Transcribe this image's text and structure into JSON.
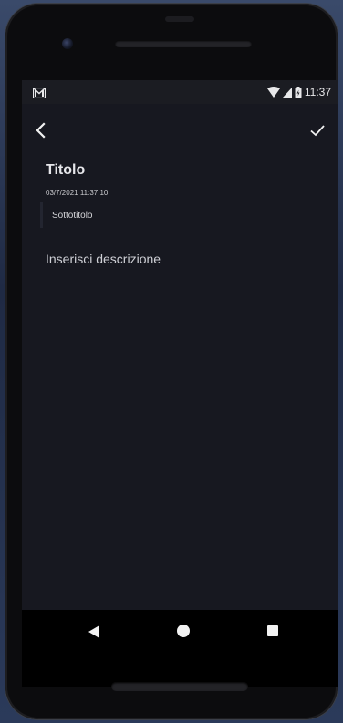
{
  "status_bar": {
    "time": "11:37",
    "left_icon": "gmail-notification-icon",
    "wifi_icon": "wifi-icon",
    "signal_icon": "cell-signal-icon",
    "battery_icon": "battery-icon"
  },
  "toolbar": {
    "back_icon": "back-arrow-icon",
    "confirm_icon": "check-icon"
  },
  "note": {
    "title": "Titolo",
    "date": "03/7/2021 11:37:10",
    "subtitle": "Sottotitolo",
    "description_placeholder": "Inserisci descrizione"
  },
  "navigation": {
    "back_icon": "nav-back-triangle-icon",
    "home_icon": "nav-home-circle-icon",
    "recents_icon": "nav-recents-square-icon"
  },
  "colors": {
    "app_background": "#171820",
    "status_bar_background": "#1b1c22",
    "text_primary": "#e6e6ea"
  }
}
